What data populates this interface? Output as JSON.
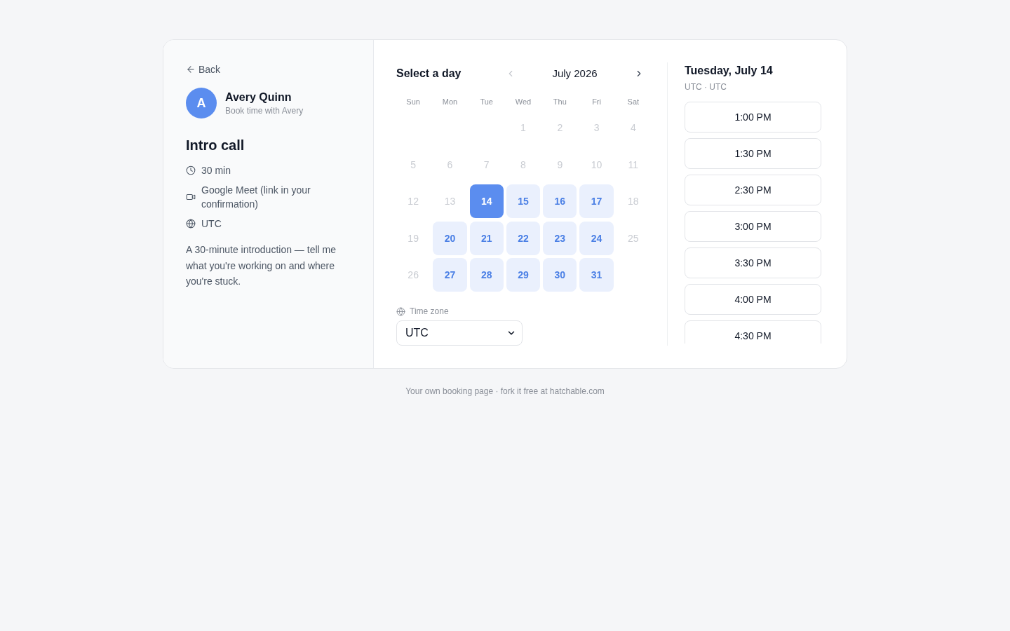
{
  "profile": {
    "back": "Back",
    "avatar_initial": "A",
    "name": "Avery Quinn",
    "subtitle": "Book time with Avery"
  },
  "event": {
    "title": "Intro call",
    "details": [
      {
        "kind": "duration",
        "text": "30 min"
      },
      {
        "kind": "video",
        "text": "Google Meet (link in your confirmation)"
      },
      {
        "kind": "timezone",
        "text": "UTC"
      }
    ],
    "description": "A 30-minute introduction — tell me what you're working on and where you're stuck."
  },
  "calendar": {
    "title": "Select a day",
    "month": "July 2026",
    "prev": {
      "disabled": true
    },
    "next": {
      "disabled": false
    },
    "weekdays": [
      "Sun",
      "Mon",
      "Tue",
      "Wed",
      "Thu",
      "Fri",
      "Sat"
    ],
    "weeks": [
      [
        {
          "label": "1",
          "available": false,
          "selected": false
        },
        {
          "label": "2",
          "available": false,
          "selected": false
        },
        {
          "label": "3",
          "available": false,
          "selected": false
        },
        {
          "label": "4",
          "available": false,
          "selected": false
        }
      ],
      [
        {
          "label": "5",
          "available": false,
          "selected": false
        },
        {
          "label": "6",
          "available": false,
          "selected": false
        },
        {
          "label": "7",
          "available": false,
          "selected": false
        },
        {
          "label": "8",
          "available": false,
          "selected": false
        },
        {
          "label": "9",
          "available": false,
          "selected": false
        },
        {
          "label": "10",
          "available": false,
          "selected": false
        },
        {
          "label": "11",
          "available": false,
          "selected": false
        }
      ],
      [
        {
          "label": "12",
          "available": false,
          "selected": false
        },
        {
          "label": "13",
          "available": false,
          "selected": false
        },
        {
          "label": "14",
          "available": true,
          "selected": true
        },
        {
          "label": "15",
          "available": true,
          "selected": false
        },
        {
          "label": "16",
          "available": true,
          "selected": false
        },
        {
          "label": "17",
          "available": true,
          "selected": false
        },
        {
          "label": "18",
          "available": false,
          "selected": false
        }
      ],
      [
        {
          "label": "19",
          "available": false,
          "selected": false
        },
        {
          "label": "20",
          "available": true,
          "selected": false
        },
        {
          "label": "21",
          "available": true,
          "selected": false
        },
        {
          "label": "22",
          "available": true,
          "selected": false
        },
        {
          "label": "23",
          "available": true,
          "selected": false
        },
        {
          "label": "24",
          "available": true,
          "selected": false
        },
        {
          "label": "25",
          "available": false,
          "selected": false
        }
      ],
      [
        {
          "label": "26",
          "available": false,
          "selected": false
        },
        {
          "label": "27",
          "available": true,
          "selected": false
        },
        {
          "label": "28",
          "available": true,
          "selected": false
        },
        {
          "label": "29",
          "available": true,
          "selected": false
        },
        {
          "label": "30",
          "available": true,
          "selected": false
        },
        {
          "label": "31",
          "available": true,
          "selected": false
        }
      ]
    ],
    "timezone_label": "Time zone",
    "timezone_value": "UTC"
  },
  "slots": {
    "date": "Tuesday, July 14",
    "timezone": "UTC · UTC",
    "times": [
      "1:00 PM",
      "1:30 PM",
      "2:30 PM",
      "3:00 PM",
      "3:30 PM",
      "4:00 PM",
      "4:30 PM"
    ]
  },
  "footer": "Your own booking page · fork it free at hatchable.com"
}
